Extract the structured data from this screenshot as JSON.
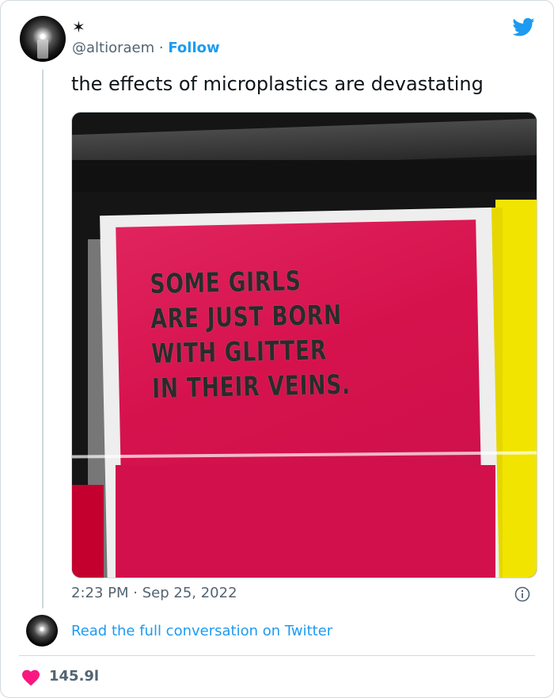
{
  "tweet": {
    "name": "✶",
    "handle": "@altioraem",
    "separator": "·",
    "follow_label": "Follow",
    "text": "the effects of microplastics are devastating",
    "time": "2:23 PM",
    "date_separator": "·",
    "date": "Sep 25, 2022",
    "likes": "145.9l"
  },
  "image_text": {
    "line1": "SOME GIRLS",
    "line2": "ARE JUST BORN",
    "line3": "WITH GLITTER",
    "line4": "IN THEIR VEINS."
  },
  "footer": {
    "read_link": "Read the full conversation on Twitter"
  },
  "colors": {
    "brand_blue": "#1d9bf0",
    "heart_pink": "#f91880",
    "muted": "#536471"
  },
  "icons": {
    "bird": "twitter-bird-icon",
    "info": "info-icon",
    "heart": "heart-icon"
  }
}
